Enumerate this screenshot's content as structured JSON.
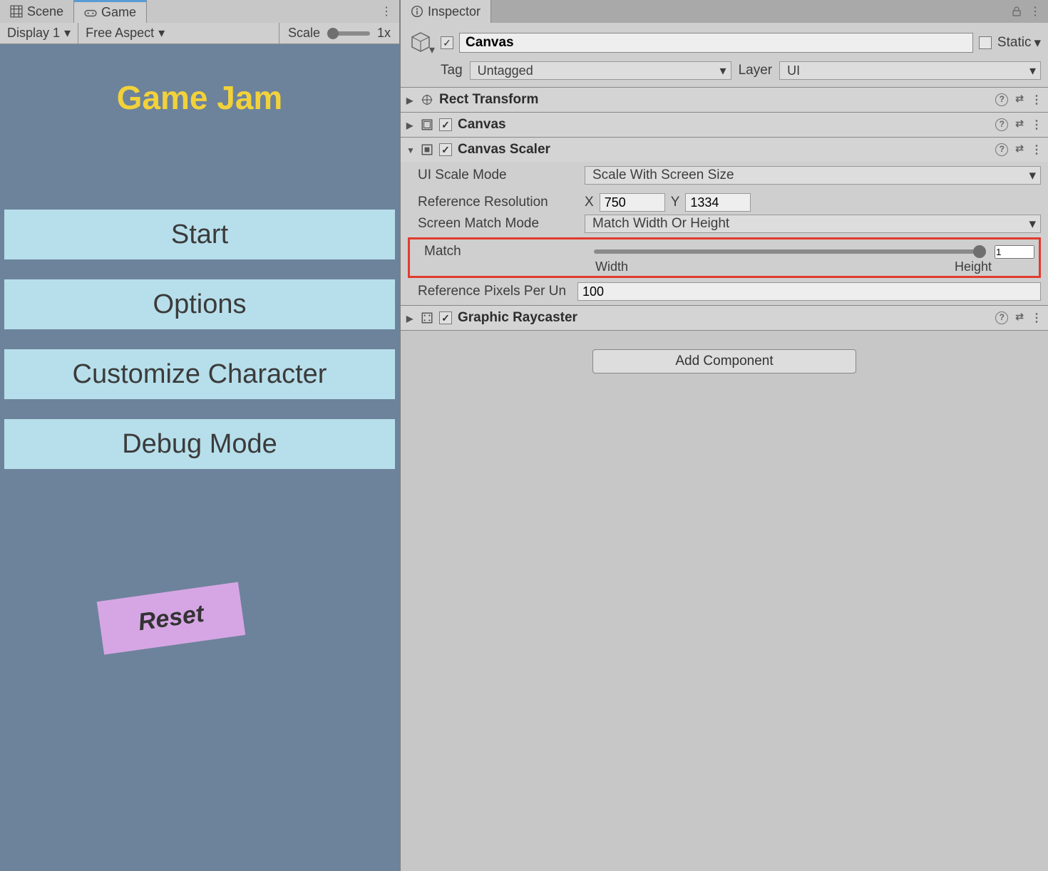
{
  "tabs": {
    "scene": "Scene",
    "game": "Game",
    "inspector": "Inspector"
  },
  "toolbar": {
    "display": "Display 1",
    "aspect": "Free Aspect",
    "scale_label": "Scale",
    "scale_value": "1x"
  },
  "game_view": {
    "title": "Game Jam",
    "btn_start": "Start",
    "btn_options": "Options",
    "btn_customize": "Customize Character",
    "btn_debug": "Debug Mode",
    "btn_reset": "Reset"
  },
  "inspector": {
    "name": "Canvas",
    "static_label": "Static",
    "tag_label": "Tag",
    "tag_value": "Untagged",
    "layer_label": "Layer",
    "layer_value": "UI",
    "components": {
      "rect": "Rect Transform",
      "canvas": "Canvas",
      "scaler": "Canvas Scaler",
      "raycaster": "Graphic Raycaster"
    },
    "scaler": {
      "mode_label": "UI Scale Mode",
      "mode_value": "Scale With Screen Size",
      "refres_label": "Reference Resolution",
      "x_label": "X",
      "x_value": "750",
      "y_label": "Y",
      "y_value": "1334",
      "matchmode_label": "Screen Match Mode",
      "matchmode_value": "Match Width Or Height",
      "match_label": "Match",
      "match_value": "1",
      "width_label": "Width",
      "height_label": "Height",
      "refpix_label": "Reference Pixels Per Un",
      "refpix_value": "100"
    },
    "add_component": "Add Component"
  }
}
